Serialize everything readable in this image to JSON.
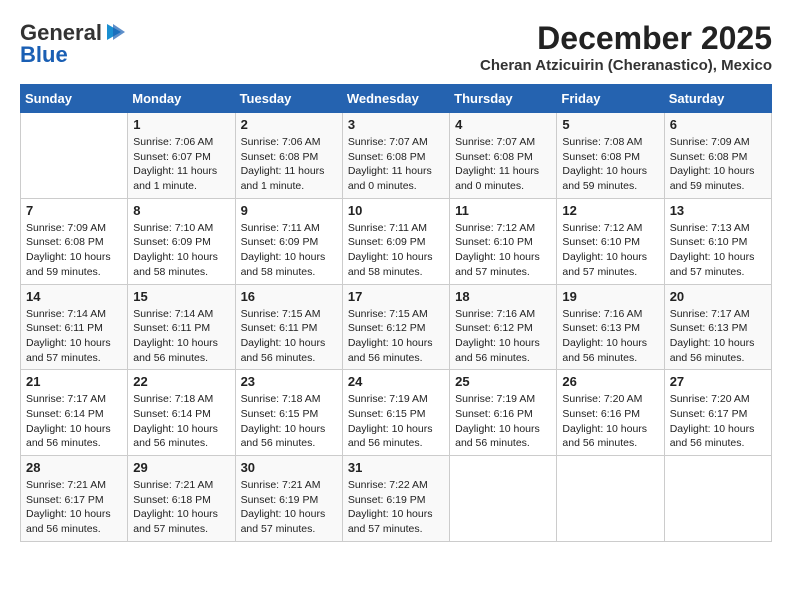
{
  "header": {
    "logo_general": "General",
    "logo_blue": "Blue",
    "month": "December 2025",
    "location": "Cheran Atzicuirin (Cheranastico), Mexico"
  },
  "weekdays": [
    "Sunday",
    "Monday",
    "Tuesday",
    "Wednesday",
    "Thursday",
    "Friday",
    "Saturday"
  ],
  "weeks": [
    [
      {
        "day": "",
        "info": ""
      },
      {
        "day": "1",
        "info": "Sunrise: 7:06 AM\nSunset: 6:07 PM\nDaylight: 11 hours\nand 1 minute."
      },
      {
        "day": "2",
        "info": "Sunrise: 7:06 AM\nSunset: 6:08 PM\nDaylight: 11 hours\nand 1 minute."
      },
      {
        "day": "3",
        "info": "Sunrise: 7:07 AM\nSunset: 6:08 PM\nDaylight: 11 hours\nand 0 minutes."
      },
      {
        "day": "4",
        "info": "Sunrise: 7:07 AM\nSunset: 6:08 PM\nDaylight: 11 hours\nand 0 minutes."
      },
      {
        "day": "5",
        "info": "Sunrise: 7:08 AM\nSunset: 6:08 PM\nDaylight: 10 hours\nand 59 minutes."
      },
      {
        "day": "6",
        "info": "Sunrise: 7:09 AM\nSunset: 6:08 PM\nDaylight: 10 hours\nand 59 minutes."
      }
    ],
    [
      {
        "day": "7",
        "info": "Sunrise: 7:09 AM\nSunset: 6:08 PM\nDaylight: 10 hours\nand 59 minutes."
      },
      {
        "day": "8",
        "info": "Sunrise: 7:10 AM\nSunset: 6:09 PM\nDaylight: 10 hours\nand 58 minutes."
      },
      {
        "day": "9",
        "info": "Sunrise: 7:11 AM\nSunset: 6:09 PM\nDaylight: 10 hours\nand 58 minutes."
      },
      {
        "day": "10",
        "info": "Sunrise: 7:11 AM\nSunset: 6:09 PM\nDaylight: 10 hours\nand 58 minutes."
      },
      {
        "day": "11",
        "info": "Sunrise: 7:12 AM\nSunset: 6:10 PM\nDaylight: 10 hours\nand 57 minutes."
      },
      {
        "day": "12",
        "info": "Sunrise: 7:12 AM\nSunset: 6:10 PM\nDaylight: 10 hours\nand 57 minutes."
      },
      {
        "day": "13",
        "info": "Sunrise: 7:13 AM\nSunset: 6:10 PM\nDaylight: 10 hours\nand 57 minutes."
      }
    ],
    [
      {
        "day": "14",
        "info": "Sunrise: 7:14 AM\nSunset: 6:11 PM\nDaylight: 10 hours\nand 57 minutes."
      },
      {
        "day": "15",
        "info": "Sunrise: 7:14 AM\nSunset: 6:11 PM\nDaylight: 10 hours\nand 56 minutes."
      },
      {
        "day": "16",
        "info": "Sunrise: 7:15 AM\nSunset: 6:11 PM\nDaylight: 10 hours\nand 56 minutes."
      },
      {
        "day": "17",
        "info": "Sunrise: 7:15 AM\nSunset: 6:12 PM\nDaylight: 10 hours\nand 56 minutes."
      },
      {
        "day": "18",
        "info": "Sunrise: 7:16 AM\nSunset: 6:12 PM\nDaylight: 10 hours\nand 56 minutes."
      },
      {
        "day": "19",
        "info": "Sunrise: 7:16 AM\nSunset: 6:13 PM\nDaylight: 10 hours\nand 56 minutes."
      },
      {
        "day": "20",
        "info": "Sunrise: 7:17 AM\nSunset: 6:13 PM\nDaylight: 10 hours\nand 56 minutes."
      }
    ],
    [
      {
        "day": "21",
        "info": "Sunrise: 7:17 AM\nSunset: 6:14 PM\nDaylight: 10 hours\nand 56 minutes."
      },
      {
        "day": "22",
        "info": "Sunrise: 7:18 AM\nSunset: 6:14 PM\nDaylight: 10 hours\nand 56 minutes."
      },
      {
        "day": "23",
        "info": "Sunrise: 7:18 AM\nSunset: 6:15 PM\nDaylight: 10 hours\nand 56 minutes."
      },
      {
        "day": "24",
        "info": "Sunrise: 7:19 AM\nSunset: 6:15 PM\nDaylight: 10 hours\nand 56 minutes."
      },
      {
        "day": "25",
        "info": "Sunrise: 7:19 AM\nSunset: 6:16 PM\nDaylight: 10 hours\nand 56 minutes."
      },
      {
        "day": "26",
        "info": "Sunrise: 7:20 AM\nSunset: 6:16 PM\nDaylight: 10 hours\nand 56 minutes."
      },
      {
        "day": "27",
        "info": "Sunrise: 7:20 AM\nSunset: 6:17 PM\nDaylight: 10 hours\nand 56 minutes."
      }
    ],
    [
      {
        "day": "28",
        "info": "Sunrise: 7:21 AM\nSunset: 6:17 PM\nDaylight: 10 hours\nand 56 minutes."
      },
      {
        "day": "29",
        "info": "Sunrise: 7:21 AM\nSunset: 6:18 PM\nDaylight: 10 hours\nand 57 minutes."
      },
      {
        "day": "30",
        "info": "Sunrise: 7:21 AM\nSunset: 6:19 PM\nDaylight: 10 hours\nand 57 minutes."
      },
      {
        "day": "31",
        "info": "Sunrise: 7:22 AM\nSunset: 6:19 PM\nDaylight: 10 hours\nand 57 minutes."
      },
      {
        "day": "",
        "info": ""
      },
      {
        "day": "",
        "info": ""
      },
      {
        "day": "",
        "info": ""
      }
    ]
  ]
}
